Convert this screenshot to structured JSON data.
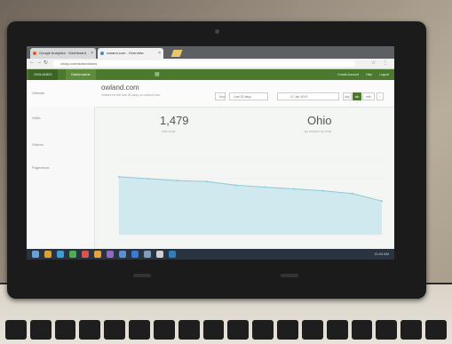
{
  "browser": {
    "tabs": [
      {
        "label": "Google Analytics · Dashboard",
        "active": false
      },
      {
        "label": "owland.com - Overview",
        "active": true
      }
    ],
    "url": "clicky.com/stats/visitors"
  },
  "app_nav": {
    "brand": "OWLANDO",
    "current_tab": "Dashboards",
    "right_links": [
      "Create Account",
      "Help",
      "Logout"
    ]
  },
  "site": {
    "label": "Website",
    "name": "owland.com",
    "subtitle": "Visitors for the last 30 days on owland.com"
  },
  "controls": {
    "range_label": "Nov",
    "range_value": "Last 30 days",
    "date_value": "21 Jan 2019",
    "segments": [
      {
        "label": "day",
        "on": false
      },
      {
        "label": "wk",
        "on": true
      },
      {
        "label": "mth",
        "on": false
      }
    ]
  },
  "sidebar": {
    "items": [
      "Visits",
      "Visitors",
      "Pageviews"
    ]
  },
  "metrics": {
    "visits_value": "1,479",
    "visits_caption": "total visits",
    "location_value": "Ohio",
    "location_caption": "top location by visits"
  },
  "chart_data": {
    "type": "area",
    "x": [
      1,
      2,
      3,
      4,
      5,
      6,
      7,
      8,
      9,
      10
    ],
    "values": [
      62,
      60,
      58,
      57,
      53,
      51,
      49,
      47,
      44,
      36
    ],
    "ylim": [
      0,
      80
    ],
    "grid": true,
    "colors": {
      "fill": "#cfe9ee",
      "line": "#8ec9d6"
    }
  },
  "taskbar": {
    "tray": "11:04 AM"
  },
  "colors": {
    "accent": "#4b7a2e",
    "screen_bg": "#f4f6f4"
  }
}
